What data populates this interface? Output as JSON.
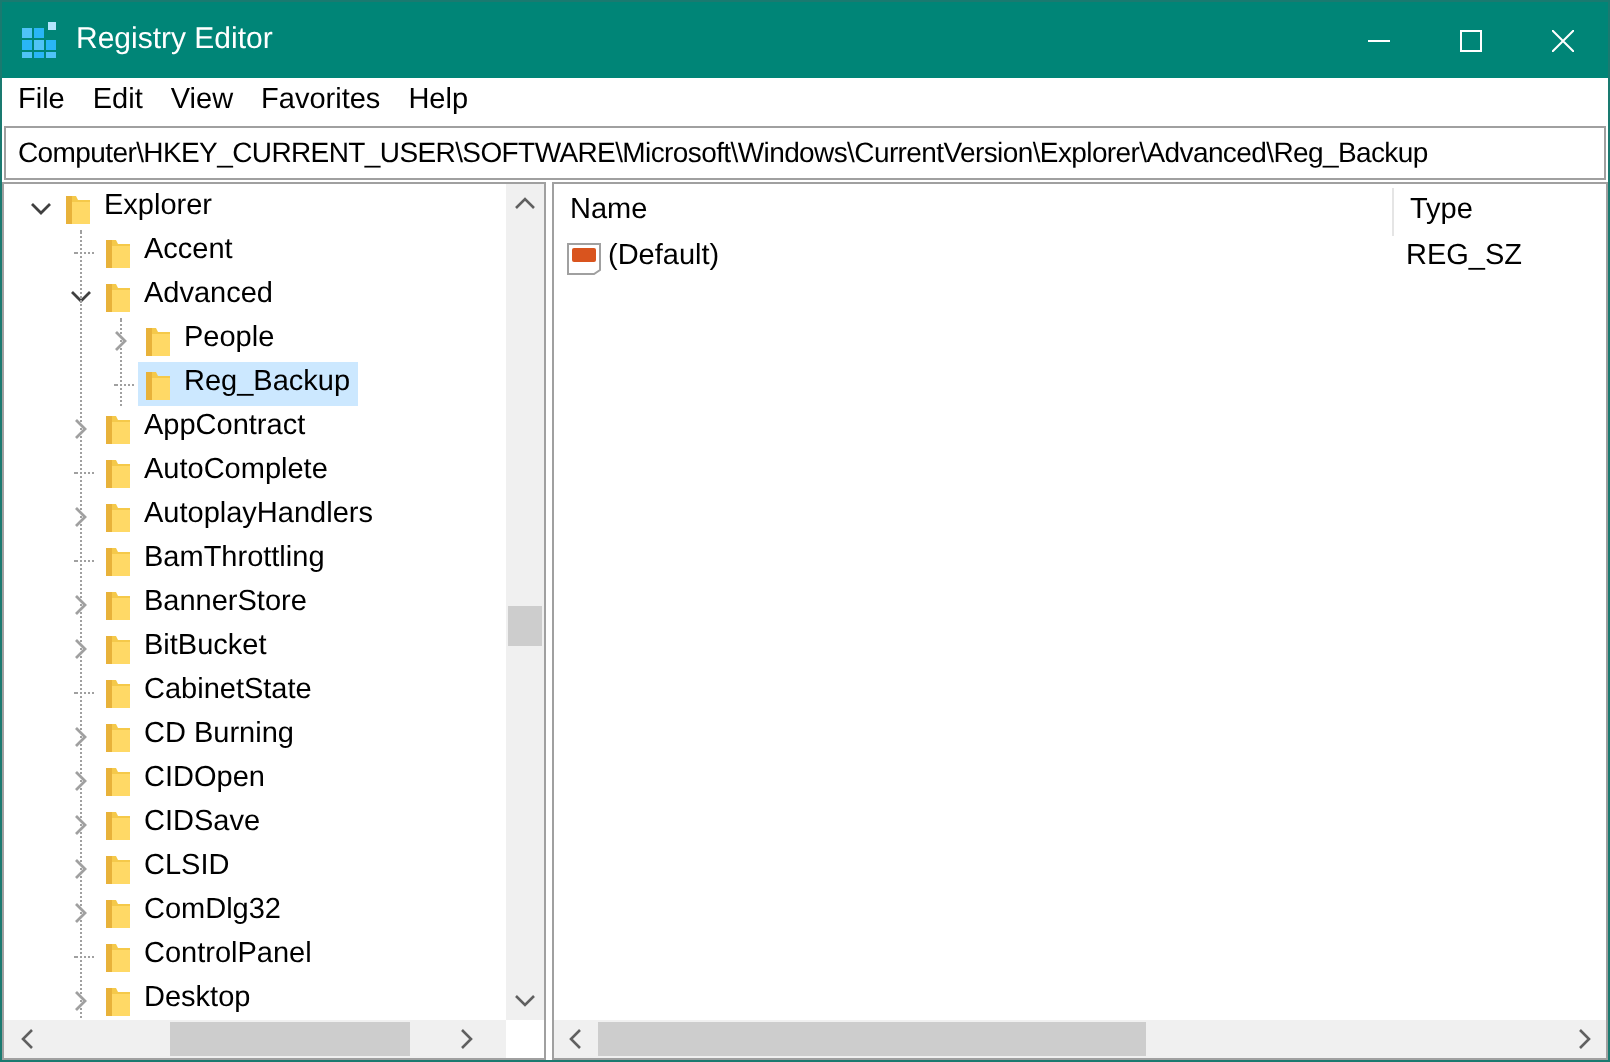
{
  "window": {
    "title": "Registry Editor"
  },
  "menu": [
    "File",
    "Edit",
    "View",
    "Favorites",
    "Help"
  ],
  "address": "Computer\\HKEY_CURRENT_USER\\SOFTWARE\\Microsoft\\Windows\\CurrentVersion\\Explorer\\Advanced\\Reg_Backup",
  "tree": [
    {
      "label": "Explorer",
      "kind": "branch",
      "expanded": true,
      "selected": false,
      "children": [
        {
          "label": "Accent",
          "kind": "leaf",
          "selected": false
        },
        {
          "label": "Advanced",
          "kind": "branch",
          "expanded": true,
          "selected": false,
          "children": [
            {
              "label": "People",
              "kind": "branch",
              "expanded": false,
              "selected": false
            },
            {
              "label": "Reg_Backup",
              "kind": "leaf",
              "selected": true
            }
          ]
        },
        {
          "label": "AppContract",
          "kind": "branch",
          "expanded": false,
          "selected": false
        },
        {
          "label": "AutoComplete",
          "kind": "leaf",
          "selected": false
        },
        {
          "label": "AutoplayHandlers",
          "kind": "branch",
          "expanded": false,
          "selected": false
        },
        {
          "label": "BamThrottling",
          "kind": "leaf",
          "selected": false
        },
        {
          "label": "BannerStore",
          "kind": "branch",
          "expanded": false,
          "selected": false
        },
        {
          "label": "BitBucket",
          "kind": "branch",
          "expanded": false,
          "selected": false
        },
        {
          "label": "CabinetState",
          "kind": "leaf",
          "selected": false
        },
        {
          "label": "CD Burning",
          "kind": "branch",
          "expanded": false,
          "selected": false
        },
        {
          "label": "CIDOpen",
          "kind": "branch",
          "expanded": false,
          "selected": false
        },
        {
          "label": "CIDSave",
          "kind": "branch",
          "expanded": false,
          "selected": false
        },
        {
          "label": "CLSID",
          "kind": "branch",
          "expanded": false,
          "selected": false
        },
        {
          "label": "ComDlg32",
          "kind": "branch",
          "expanded": false,
          "selected": false
        },
        {
          "label": "ControlPanel",
          "kind": "leaf",
          "selected": false
        },
        {
          "label": "Desktop",
          "kind": "branch",
          "expanded": false,
          "selected": false
        }
      ]
    }
  ],
  "values": {
    "columns": [
      "Name",
      "Type"
    ],
    "rows": [
      {
        "name": "(Default)",
        "type": "REG_SZ"
      }
    ]
  }
}
